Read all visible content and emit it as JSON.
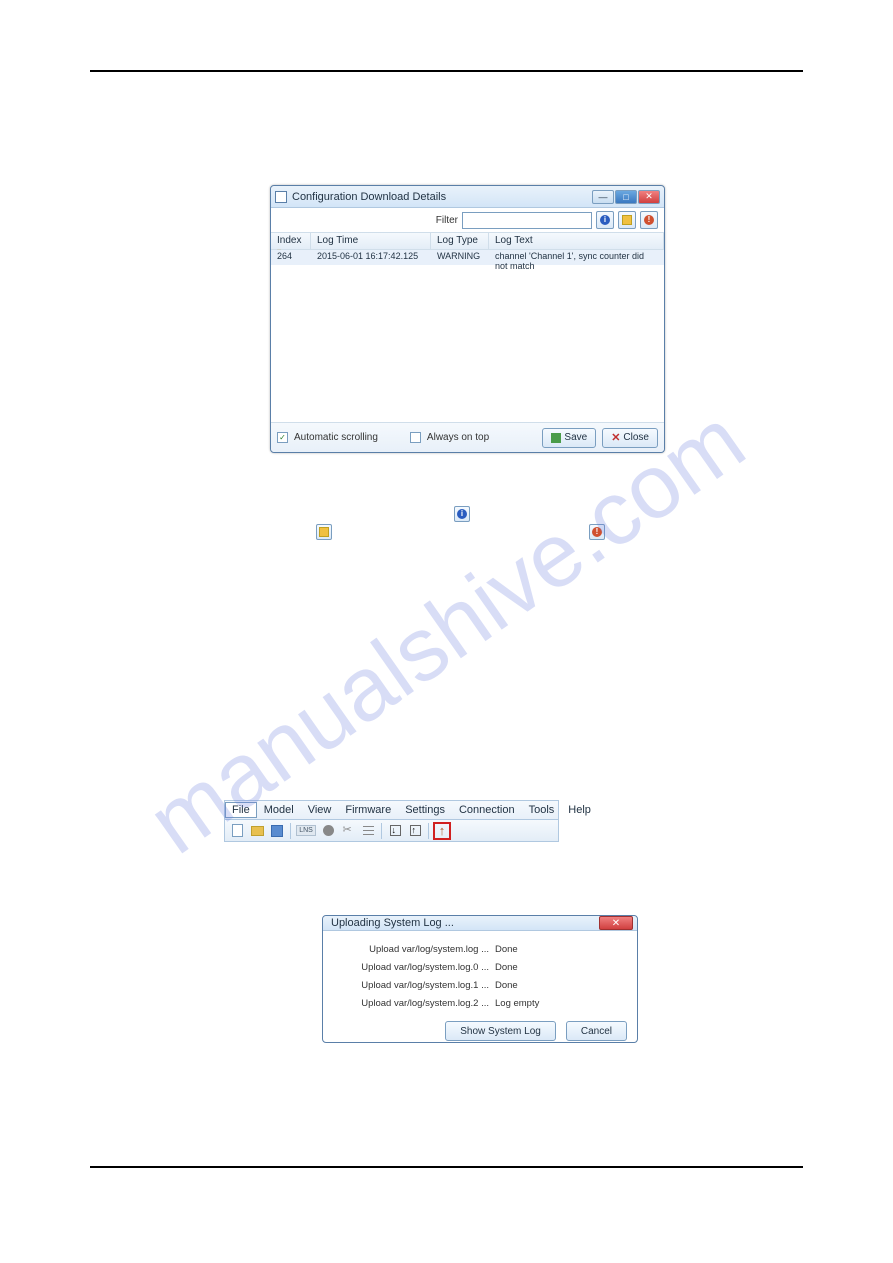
{
  "watermark": "manualshive.com",
  "dialog1": {
    "title": "Configuration Download Details",
    "filter_label": "Filter",
    "filter_value": "",
    "headers": {
      "index": "Index",
      "logtime": "Log Time",
      "logtype": "Log Type",
      "logtext": "Log Text"
    },
    "row": {
      "index": "264",
      "logtime": "2015-06-01 16:17:42.125",
      "logtype": "WARNING",
      "logtext": "channel 'Channel 1', sync counter did not match"
    },
    "auto_scroll_label": "Automatic scrolling",
    "auto_scroll_checked": true,
    "always_on_top_label": "Always on top",
    "always_on_top_checked": false,
    "save_btn": "Save",
    "close_btn": "Close"
  },
  "menubar": {
    "items": [
      "File",
      "Model",
      "View",
      "Firmware",
      "Settings",
      "Connection",
      "Tools",
      "Help"
    ]
  },
  "dialog2": {
    "title": "Uploading System Log ...",
    "rows": [
      {
        "file": "Upload var/log/system.log ...",
        "status": "Done"
      },
      {
        "file": "Upload var/log/system.log.0 ...",
        "status": "Done"
      },
      {
        "file": "Upload var/log/system.log.1 ...",
        "status": "Done"
      },
      {
        "file": "Upload var/log/system.log.2 ...",
        "status": "Log empty"
      }
    ],
    "show_btn": "Show System Log",
    "cancel_btn": "Cancel"
  }
}
